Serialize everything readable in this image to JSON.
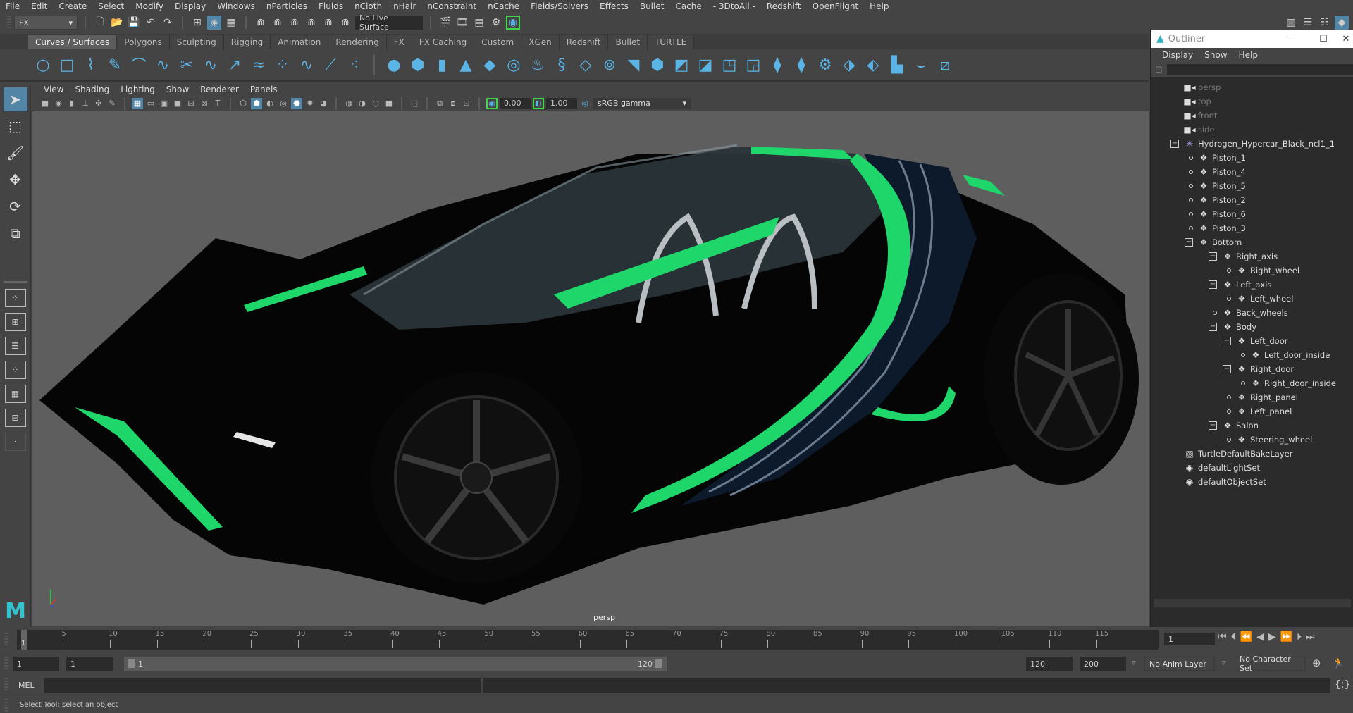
{
  "menubar": {
    "items": [
      "File",
      "Edit",
      "Create",
      "Select",
      "Modify",
      "Display",
      "Windows",
      "nParticles",
      "Fluids",
      "nCloth",
      "nHair",
      "nConstraint",
      "nCache",
      "Fields/Solvers",
      "Effects",
      "Bullet",
      "Cache",
      "- 3DtoAll -",
      "Redshift",
      "OpenFlight",
      "Help"
    ]
  },
  "statusline": {
    "menuset": "FX",
    "live_surface": "No Live Surface"
  },
  "shelf": {
    "tabs": [
      "Curves / Surfaces",
      "Polygons",
      "Sculpting",
      "Rigging",
      "Animation",
      "Rendering",
      "FX",
      "FX Caching",
      "Custom",
      "XGen",
      "Redshift",
      "Bullet",
      "TURTLE"
    ],
    "active_tab": "Curves / Surfaces"
  },
  "viewport": {
    "menu": [
      "View",
      "Shading",
      "Lighting",
      "Show",
      "Renderer",
      "Panels"
    ],
    "exposure": "0.00",
    "gamma": "1.00",
    "color_space": "sRGB gamma",
    "camera_label": "persp",
    "accent_green": "#1fd66a"
  },
  "outliner": {
    "title": "Outliner",
    "menu": [
      "Display",
      "Show",
      "Help"
    ],
    "items": [
      {
        "label": "persp",
        "type": "camera",
        "depth": 0
      },
      {
        "label": "top",
        "type": "camera",
        "depth": 0
      },
      {
        "label": "front",
        "type": "camera",
        "depth": 0
      },
      {
        "label": "side",
        "type": "camera",
        "depth": 0
      },
      {
        "label": "Hydrogen_Hypercar_Black_ncl1_1",
        "type": "group-root",
        "depth": 0,
        "expanded": true
      },
      {
        "label": "Piston_1",
        "type": "mesh",
        "depth": 1
      },
      {
        "label": "Piston_4",
        "type": "mesh",
        "depth": 1
      },
      {
        "label": "Piston_5",
        "type": "mesh",
        "depth": 1
      },
      {
        "label": "Piston_2",
        "type": "mesh",
        "depth": 1
      },
      {
        "label": "Piston_6",
        "type": "mesh",
        "depth": 1
      },
      {
        "label": "Piston_3",
        "type": "mesh",
        "depth": 1
      },
      {
        "label": "Bottom",
        "type": "mesh",
        "depth": 1,
        "expanded": true
      },
      {
        "label": "Right_axis",
        "type": "mesh",
        "depth": 2,
        "expanded": true
      },
      {
        "label": "Right_wheel",
        "type": "mesh",
        "depth": 3
      },
      {
        "label": "Left_axis",
        "type": "mesh",
        "depth": 2,
        "expanded": true
      },
      {
        "label": "Left_wheel",
        "type": "mesh",
        "depth": 3
      },
      {
        "label": "Back_wheels",
        "type": "mesh",
        "depth": 2
      },
      {
        "label": "Body",
        "type": "mesh",
        "depth": 2,
        "expanded": true
      },
      {
        "label": "Left_door",
        "type": "mesh",
        "depth": 3,
        "expanded": true
      },
      {
        "label": "Left_door_inside",
        "type": "mesh",
        "depth": 4
      },
      {
        "label": "Right_door",
        "type": "mesh",
        "depth": 3,
        "expanded": true
      },
      {
        "label": "Right_door_inside",
        "type": "mesh",
        "depth": 4
      },
      {
        "label": "Right_panel",
        "type": "mesh",
        "depth": 3
      },
      {
        "label": "Left_panel",
        "type": "mesh",
        "depth": 3
      },
      {
        "label": "Salon",
        "type": "mesh",
        "depth": 2,
        "expanded": true
      },
      {
        "label": "Steering_wheel",
        "type": "mesh",
        "depth": 3
      },
      {
        "label": "TurtleDefaultBakeLayer",
        "type": "layer",
        "depth": 0
      },
      {
        "label": "defaultLightSet",
        "type": "set",
        "depth": 0
      },
      {
        "label": "defaultObjectSet",
        "type": "set",
        "depth": 0
      }
    ]
  },
  "timeline": {
    "ticks": [
      "5",
      "10",
      "15",
      "20",
      "25",
      "30",
      "35",
      "40",
      "45",
      "50",
      "55",
      "60",
      "65",
      "70",
      "75",
      "80",
      "85",
      "90",
      "95",
      "100",
      "105",
      "110",
      "115"
    ],
    "current_frame_marker": "1",
    "current_frame": "1"
  },
  "range": {
    "start": "1",
    "playback_start": "1",
    "slider_start": "1",
    "slider_end": "120",
    "playback_end": "120",
    "end": "200",
    "anim_layer": "No Anim Layer",
    "character_set": "No Character Set"
  },
  "cmdline": {
    "label": "MEL"
  },
  "helpline": {
    "text": "Select Tool: select an object"
  }
}
